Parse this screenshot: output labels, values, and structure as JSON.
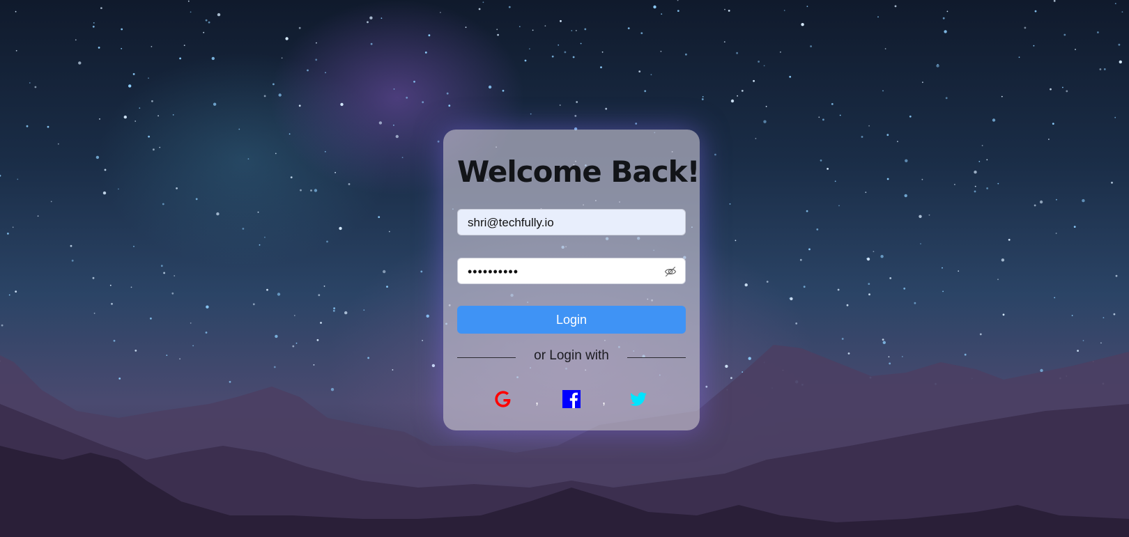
{
  "login": {
    "title": "Welcome Back!",
    "email_value": "shri@techfully.io",
    "password_masked": "••••••••••",
    "login_label": "Login",
    "divider_text": "or Login with",
    "separator": ","
  },
  "social": {
    "icons": [
      "google-icon",
      "facebook-icon",
      "twitter-icon"
    ]
  },
  "colors": {
    "login_button": "#3f93f5",
    "google": "#ff0000",
    "facebook": "#0000ff",
    "twitter": "#00e5ff"
  }
}
